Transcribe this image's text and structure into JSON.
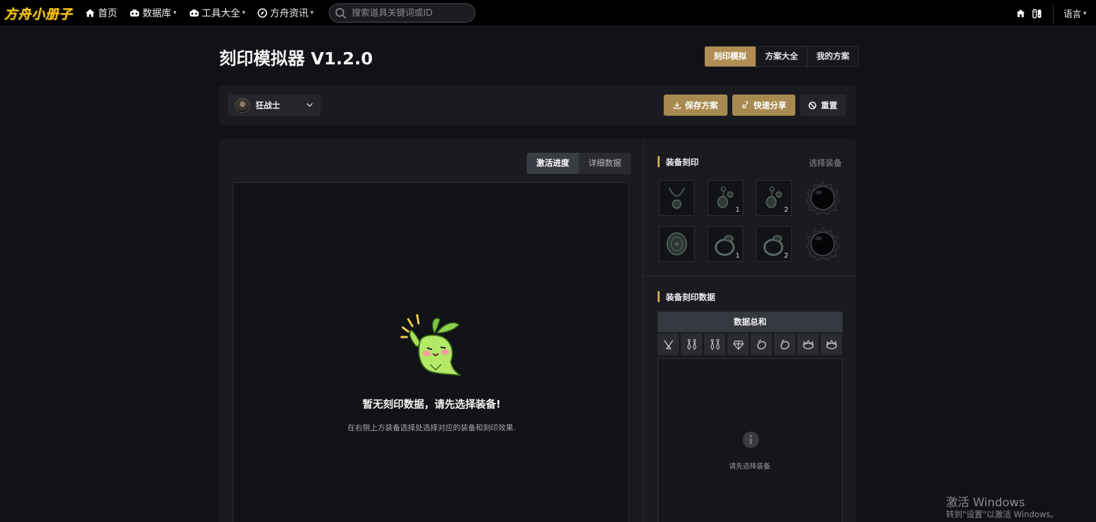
{
  "nav": {
    "logo": "方舟小册子",
    "items": [
      {
        "label": "首页",
        "icon": "home-icon",
        "has_dropdown": false
      },
      {
        "label": "数据库",
        "icon": "database-icon",
        "has_dropdown": true
      },
      {
        "label": "工具大全",
        "icon": "toolbox-icon",
        "has_dropdown": true
      },
      {
        "label": "方舟资讯",
        "icon": "compass-icon",
        "has_dropdown": true
      }
    ],
    "search_placeholder": "搜索道具关键词或ID",
    "language_label": "语言"
  },
  "page": {
    "title": "刻印模拟器 V1.2.0",
    "mode_tabs": [
      {
        "label": "刻印模拟",
        "active": true
      },
      {
        "label": "方案大全",
        "active": false
      },
      {
        "label": "我的方案",
        "active": false
      }
    ]
  },
  "toolbar": {
    "class_name": "狂战士",
    "save_label": "保存方案",
    "share_label": "快速分享",
    "reset_label": "重置"
  },
  "left": {
    "view_tabs": [
      {
        "label": "激活进度",
        "active": true
      },
      {
        "label": "详细数据",
        "active": false
      }
    ],
    "empty_title": "暂无刻印数据，请先选择装备!",
    "empty_subtitle": "在右侧上方装备选择处选择对应的装备和刻印效果."
  },
  "right": {
    "equip_section_title": "装备刻印",
    "select_equip_label": "选择装备",
    "slots": [
      {
        "name": "necklace-slot",
        "num": ""
      },
      {
        "name": "earring-slot-1",
        "num": "1"
      },
      {
        "name": "earring-slot-2",
        "num": "2"
      },
      {
        "name": "stone-slot-top",
        "num": ""
      },
      {
        "name": "shield-slot",
        "num": ""
      },
      {
        "name": "ring-slot-1",
        "num": "1"
      },
      {
        "name": "ring-slot-2",
        "num": "2"
      },
      {
        "name": "stone-slot-bottom",
        "num": ""
      }
    ],
    "data_section_title": "装备刻印数据",
    "sum_header": "数据总和",
    "stat_icons": [
      "necklace-icon",
      "earring-icon",
      "earring-icon",
      "gem-icon",
      "bracelet-icon",
      "bracelet-icon",
      "crown-icon",
      "crown-icon"
    ],
    "data_hint": "请先选择装备."
  },
  "watermark": {
    "line1": "激活 Windows",
    "line2": "转到\"设置\"以激活 Windows。"
  },
  "colors": {
    "accent_gold": "#b08d52",
    "section_bar": "#d4a74a",
    "logo_yellow": "#f5c518"
  }
}
